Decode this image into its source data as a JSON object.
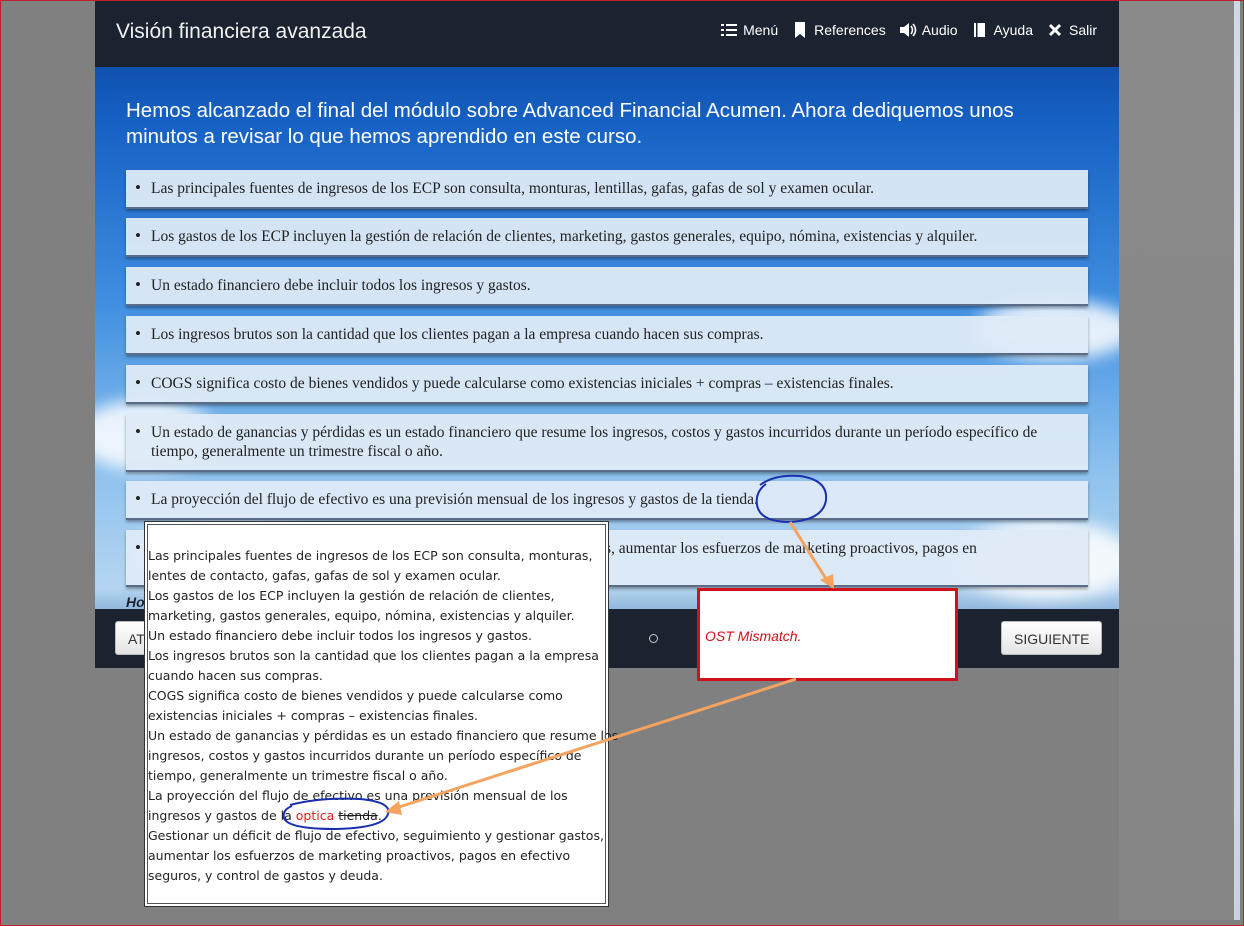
{
  "header": {
    "title": "Visión financiera avanzada",
    "nav": [
      {
        "label": "Menú",
        "icon": "menu-list-icon"
      },
      {
        "label": "References",
        "icon": "bookmark-icon"
      },
      {
        "label": "Audio",
        "icon": "speaker-icon"
      },
      {
        "label": "Ayuda",
        "icon": "book-icon"
      },
      {
        "label": "Salir",
        "icon": "close-icon"
      }
    ]
  },
  "main": {
    "heading": "Hemos alcanzado el final del módulo sobre Advanced Financial Acumen. Ahora dediquemos unos minutos a revisar lo que hemos aprendido en este curso.",
    "bullets": [
      "Las principales fuentes de ingresos de los ECP son consulta, monturas, lentillas, gafas, gafas de sol y examen ocular.",
      "Los gastos de los ECP incluyen la gestión de relación de clientes, marketing, gastos generales, equipo, nómina, existencias y alquiler.",
      "Un estado financiero debe incluir todos los ingresos y gastos.",
      "Los ingresos brutos son la cantidad que los clientes pagan a la empresa cuando hacen sus compras.",
      "COGS significa costo de bienes vendidos y puede calcularse como existencias iniciales + compras – existencias finales.",
      "Un estado de ganancias y pérdidas es un estado financiero que resume los ingresos, costos y gastos incurridos durante un período específico de tiempo, generalmente un trimestre fiscal o año.",
      "La proyección del flujo de efectivo es una previsión mensual de los ingresos y gastos de la tienda.",
      "astos, aumentar los esfuerzos de marketing proactivos, pagos en"
    ],
    "hint_visible": "Ho"
  },
  "footer": {
    "back_label": "AT",
    "next_label": "SIGUIENTE"
  },
  "source_text": {
    "lines": [
      "Las principales fuentes de ingresos de los ECP son consulta, monturas,",
      "lentes de contacto, gafas, gafas de sol y examen ocular.",
      "Los gastos de los ECP incluyen la gestión de relación de clientes,",
      "marketing, gastos generales, equipo, nómina, existencias y alquiler.",
      "Un estado financiero debe incluir todos los ingresos y gastos.",
      "Los ingresos brutos son la cantidad que los clientes pagan a la empresa",
      "cuando hacen sus compras.",
      "COGS significa costo de bienes vendidos y puede calcularse como",
      "existencias iniciales + compras – existencias finales.",
      "Un estado de ganancias y pérdidas es un estado financiero que resume los",
      "ingresos, costos y gastos incurridos durante un período específico de",
      "tiempo, generalmente un trimestre fiscal o año.",
      "La proyección del flujo de efectivo es una previsión mensual de los"
    ],
    "edit_line_prefix": "ingresos y gastos de la ",
    "inserted_word": "optica",
    "deleted_word": "tienda",
    "edit_line_suffix": ".",
    "lines_after": [
      "Gestionar un déficit de flujo de efectivo, seguimiento y gestionar gastos,",
      "aumentar los esfuerzos de marketing proactivos, pagos en efectivo",
      "seguros, y control de gastos y deuda."
    ]
  },
  "annotation": {
    "label": "OST Mismatch.",
    "box_color": "#d0101a",
    "arrow_color": "#f4a460",
    "circle_color": "#1a2fb0"
  }
}
